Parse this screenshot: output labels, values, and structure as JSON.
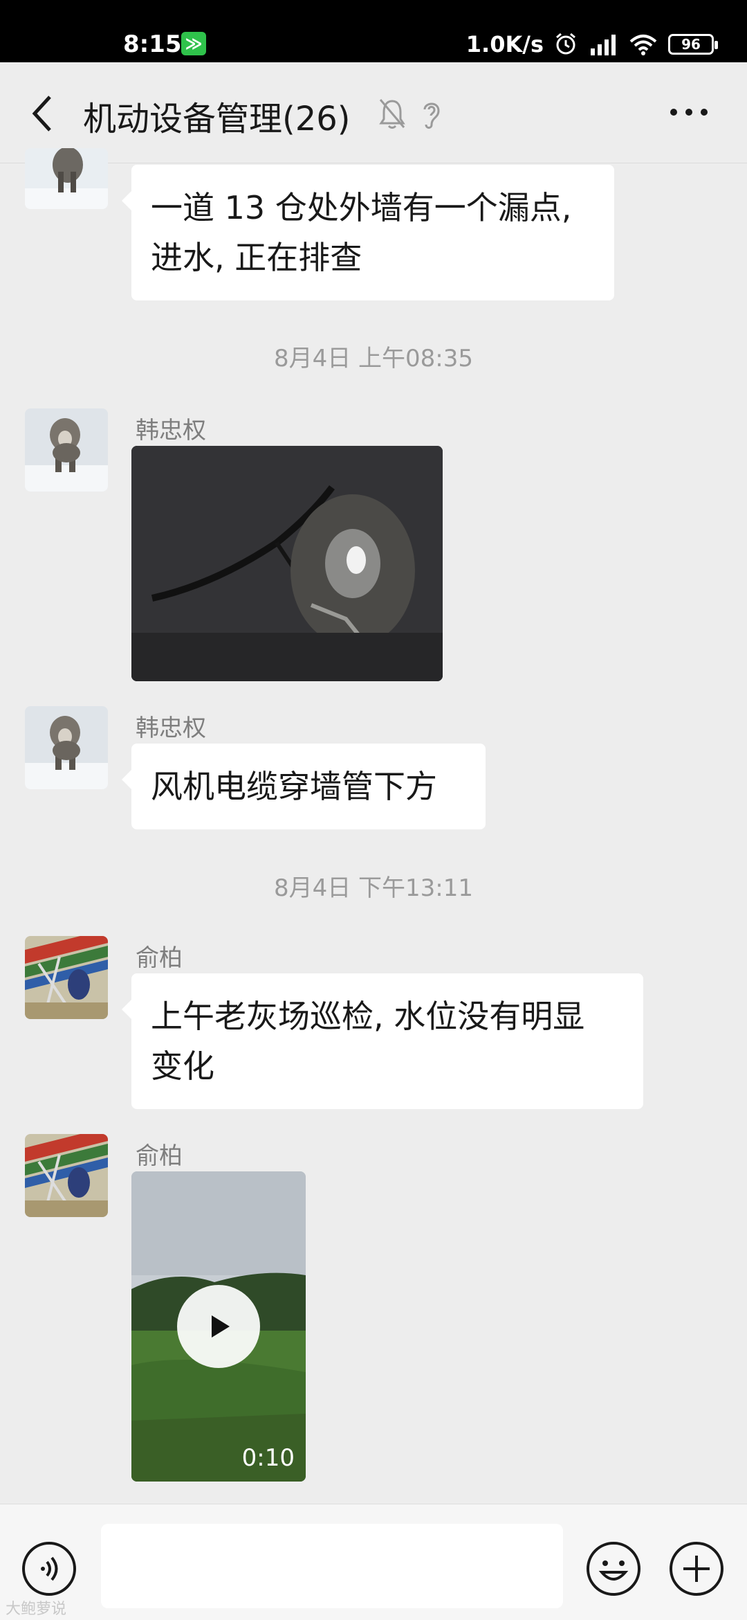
{
  "status_bar": {
    "time": "8:15",
    "app_badge": "≫",
    "net_speed": "1.0K/s",
    "battery": "96"
  },
  "header": {
    "title": "机动设备管理(26)"
  },
  "messages": [
    {
      "type": "text",
      "text_line1": "一道 13 仓处外墙有一个漏点,",
      "text_line2": "进水, 正在排查"
    },
    {
      "type": "time",
      "text": "8月4日 上午08:35"
    },
    {
      "type": "image",
      "sender": "韩忠权"
    },
    {
      "type": "text",
      "sender": "韩忠权",
      "text": "风机电缆穿墙管下方"
    },
    {
      "type": "time",
      "text": "8月4日 下午13:11"
    },
    {
      "type": "text",
      "sender": "俞柏",
      "text_line1": "上午老灰场巡检, 水位没有明显",
      "text_line2": "变化"
    },
    {
      "type": "video",
      "sender": "俞柏",
      "duration": "0:10"
    }
  ],
  "input": {
    "placeholder": ""
  },
  "watermark": "大鲍萝说",
  "colors": {
    "bubble": "#ffffff",
    "background": "#ededed",
    "status_bar": "#000000",
    "badge": "#2fc24b"
  },
  "icons": [
    "back-icon",
    "mute-bell-icon",
    "ear-icon",
    "more-icon",
    "voice-icon",
    "emoji-icon",
    "plus-icon",
    "play-icon",
    "alarm-icon",
    "signal-icon",
    "wifi-icon",
    "battery-icon"
  ]
}
